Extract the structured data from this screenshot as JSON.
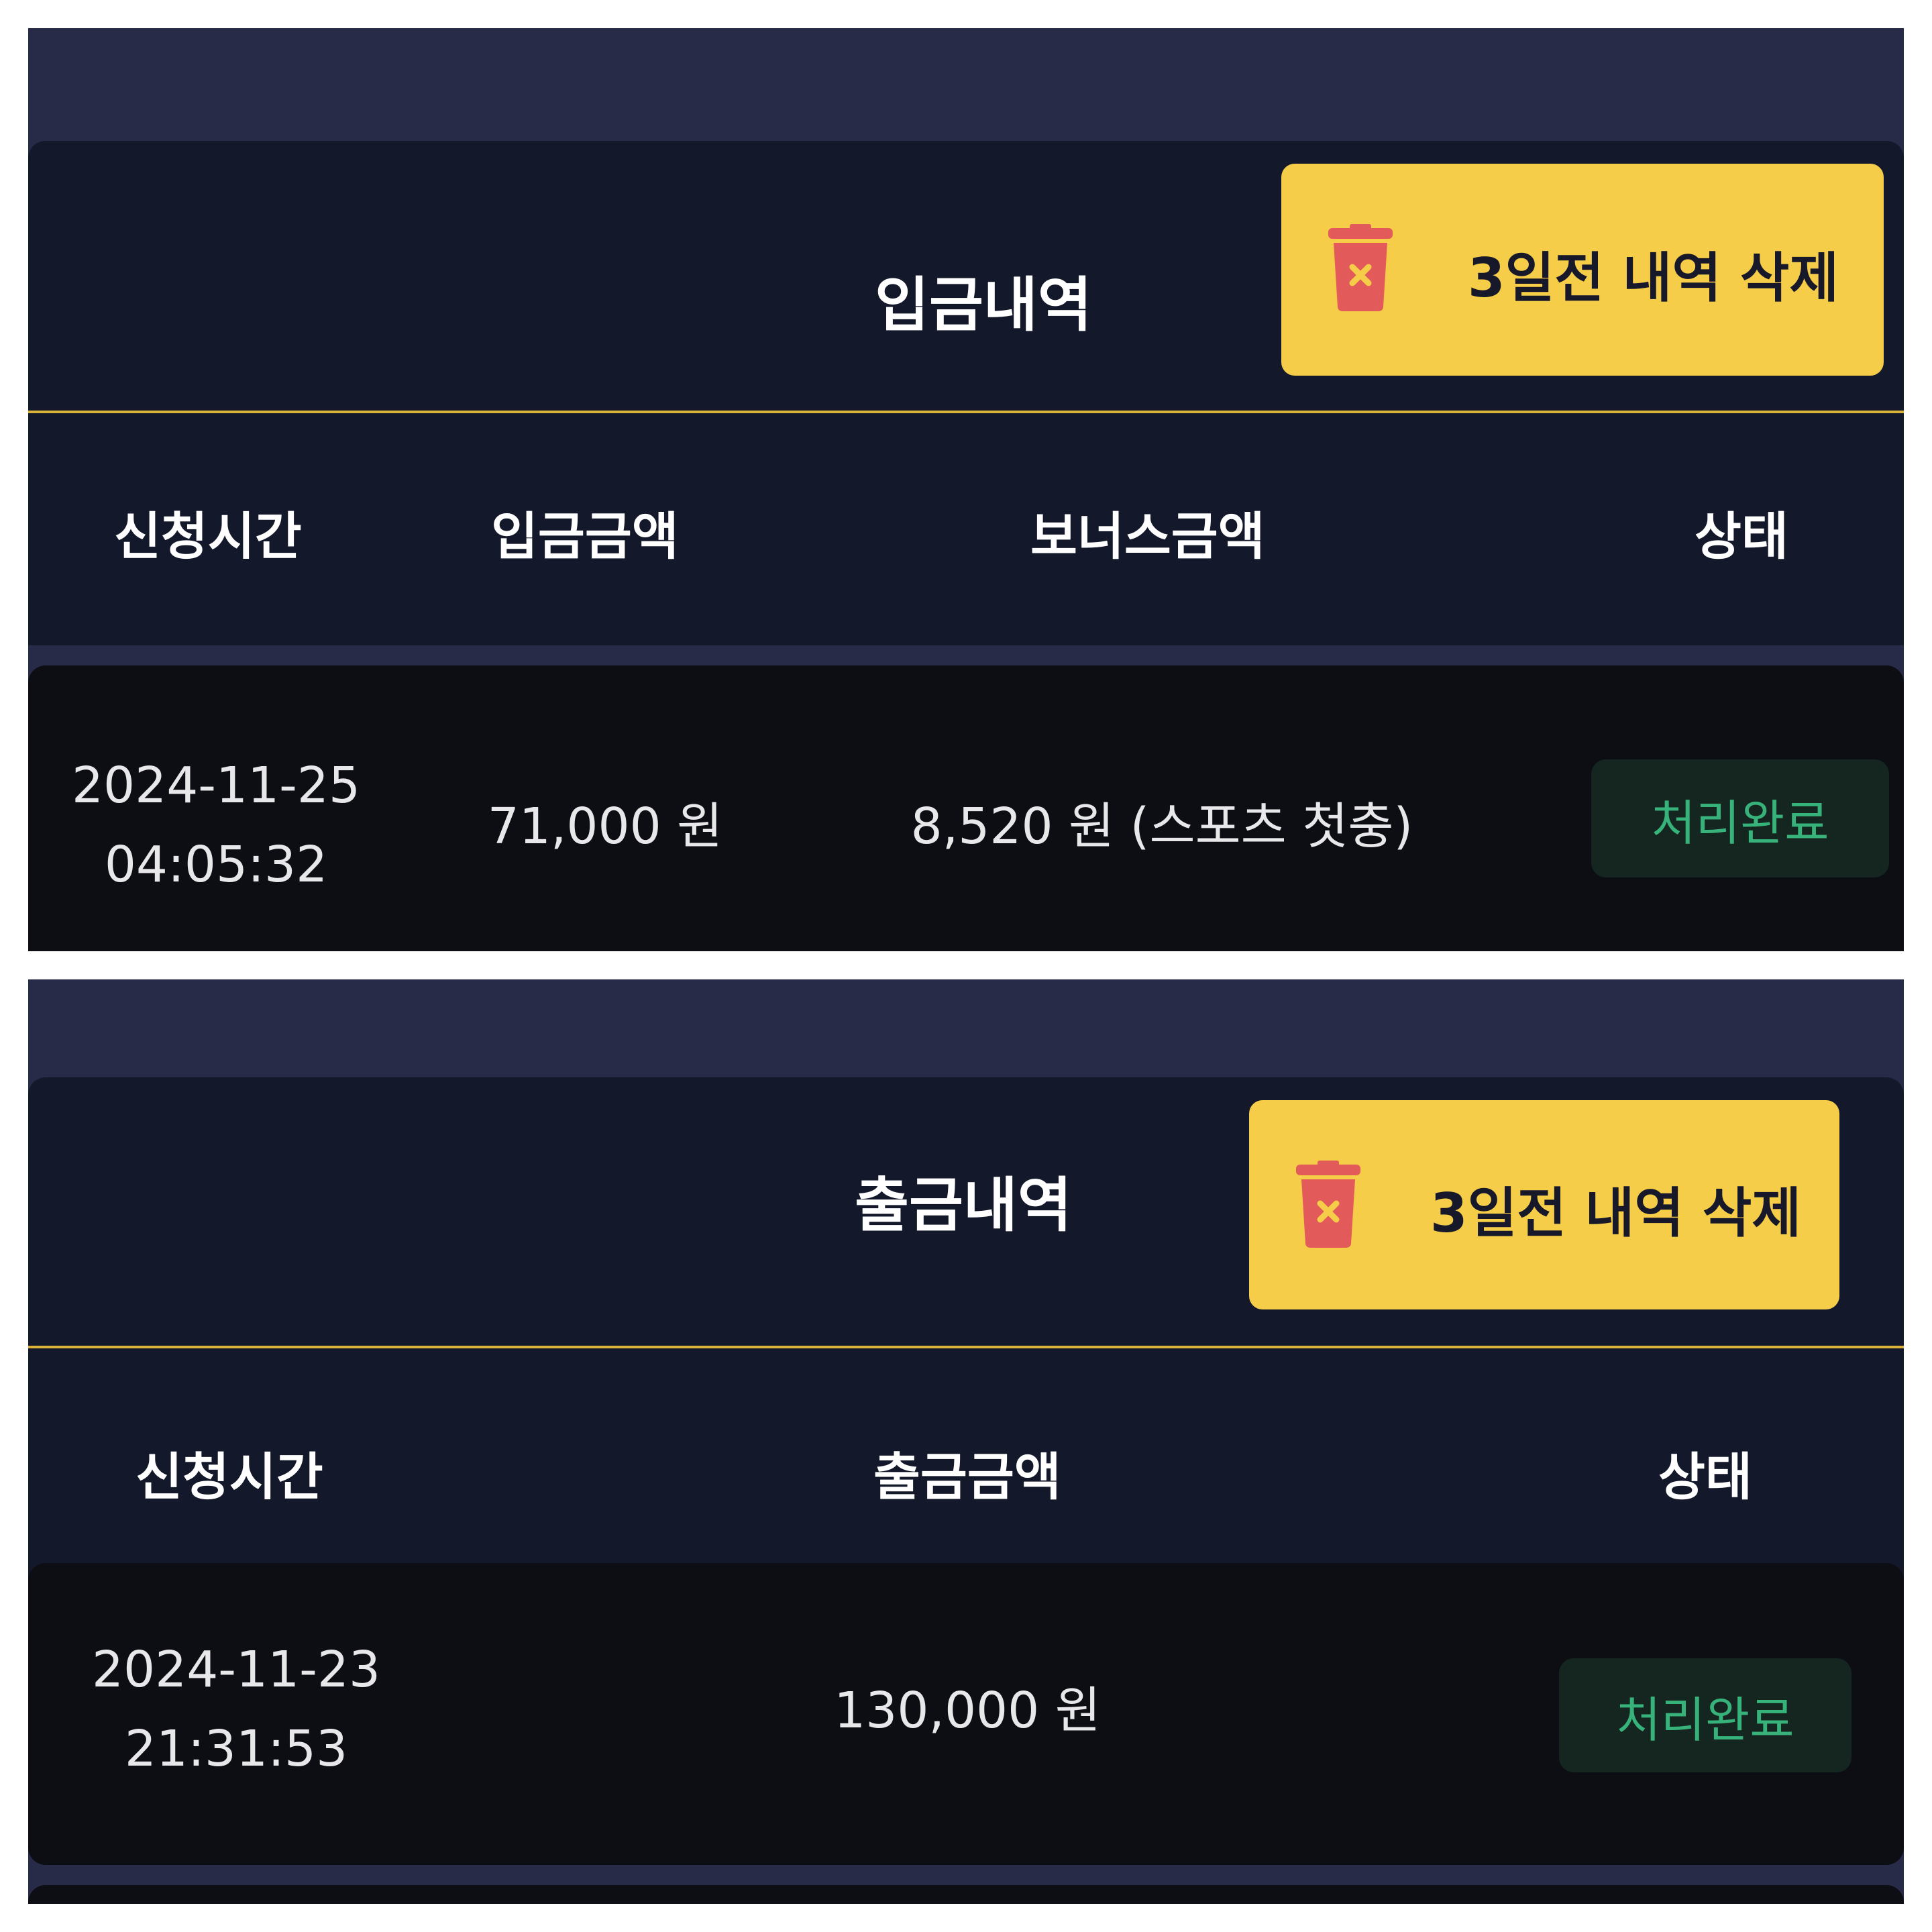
{
  "deposit_panel": {
    "title": "입금내역",
    "delete_button_label": "3일전 내역 삭제",
    "columns": [
      "신청시간",
      "입금금액",
      "보너스금액",
      "상태"
    ],
    "rows": [
      {
        "date": "2024-11-25",
        "time": "04:05:32",
        "amount": "71,000 원",
        "bonus": "8,520 원 (스포츠 첫충)",
        "status": "처리완료"
      }
    ]
  },
  "withdraw_panel": {
    "title": "출금내역",
    "delete_button_label": "3일전 내역 삭제",
    "columns": [
      "신청시간",
      "출금금액",
      "상태"
    ],
    "rows": [
      {
        "date": "2024-11-23",
        "time": "21:31:53",
        "amount": "130,000 원",
        "status": "처리완료"
      }
    ]
  },
  "icons": {
    "delete": "trash-icon"
  },
  "colors": {
    "page_background": "#272b47",
    "header_background": "#14182b",
    "row_background": "#0c0e14",
    "accent_yellow": "#f6cd48",
    "divider_gold": "#d9b23a",
    "status_green": "#36b27a",
    "trash_red": "#e35a5a"
  }
}
